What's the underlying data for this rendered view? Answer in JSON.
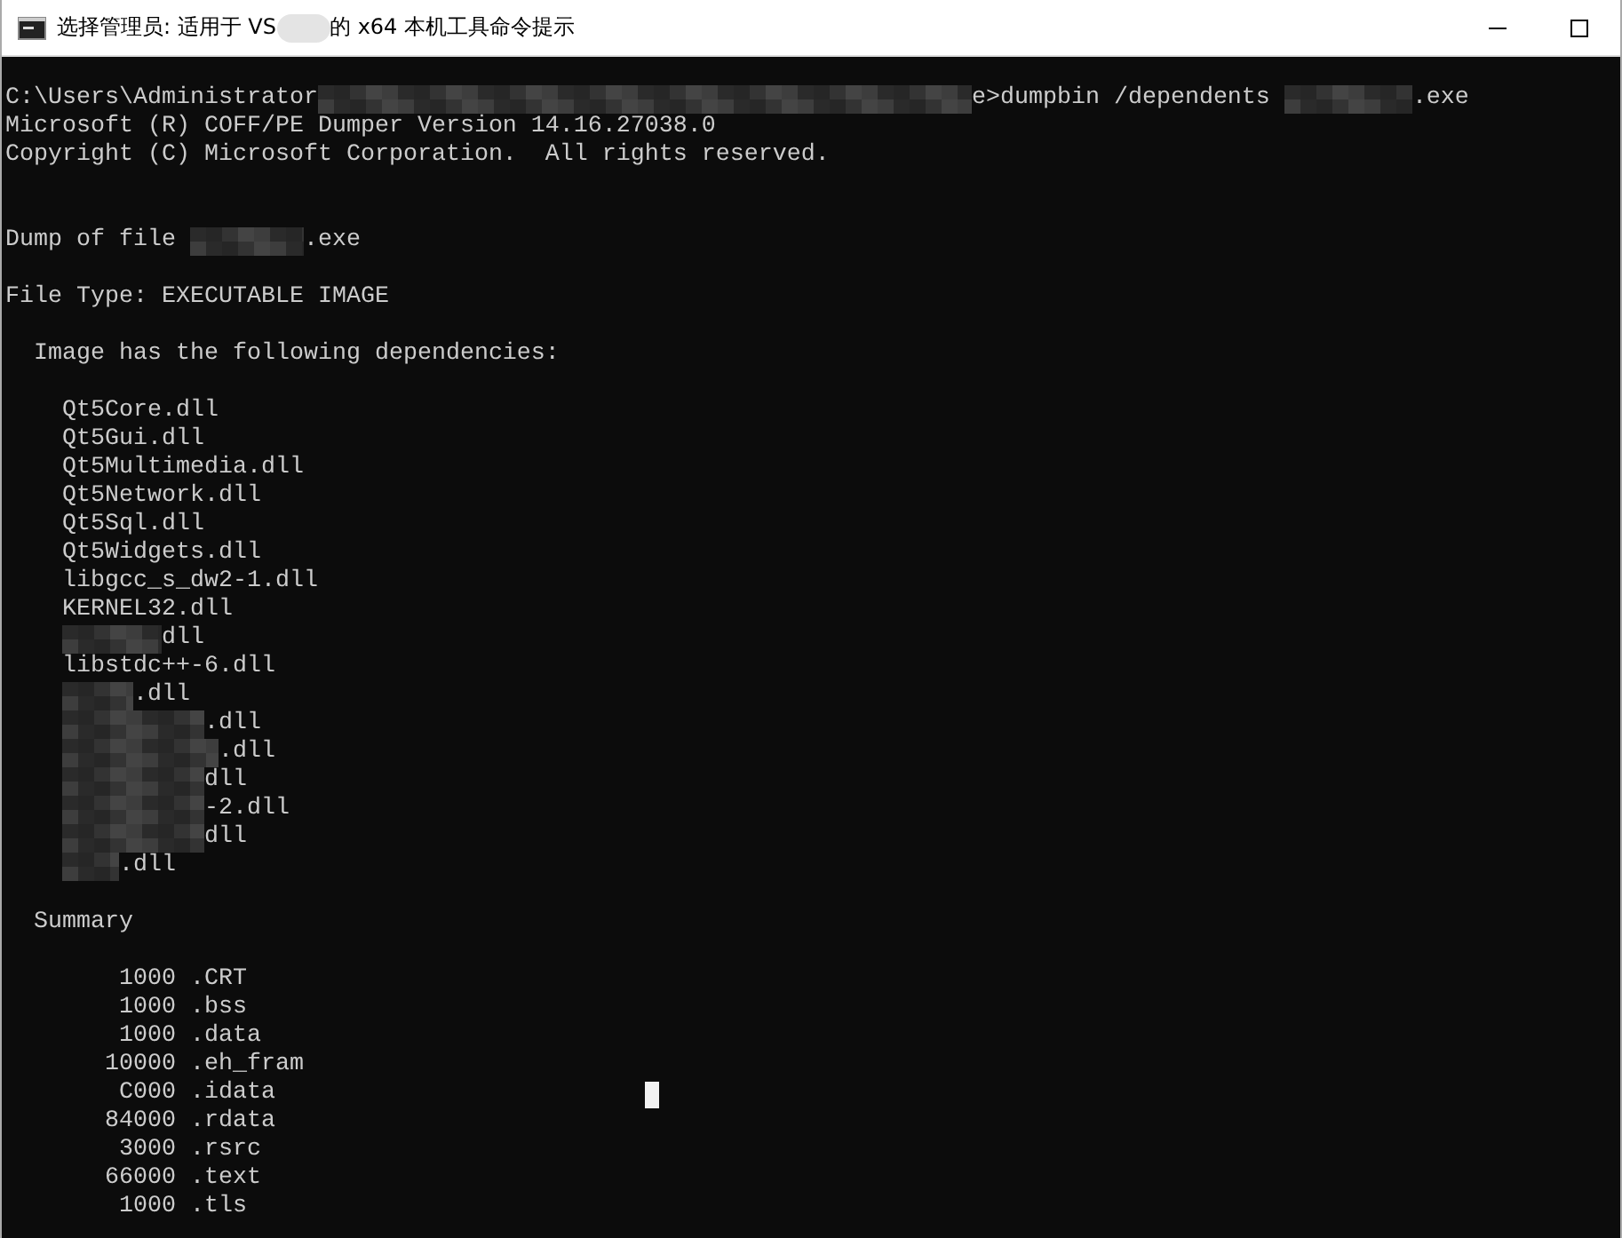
{
  "window": {
    "title": [
      {
        "kind": "text",
        "text": "选择管理员: 适用于 VS"
      },
      {
        "kind": "redacted"
      },
      {
        "kind": "text",
        "text": "的 x64 本机工具命令提示"
      }
    ]
  },
  "console": {
    "blocks": [
      [
        [
          {
            "kind": "text",
            "text": "C:\\Users\\Administrator"
          },
          {
            "kind": "redacted"
          },
          {
            "kind": "text",
            "text": "e>dumpbin /dependents "
          },
          {
            "kind": "redacted"
          },
          {
            "kind": "text",
            "text": ".exe"
          }
        ],
        [
          {
            "kind": "text",
            "text": "Microsoft (R) COFF/PE Dumper Version 14.16.27038.0"
          }
        ],
        [
          {
            "kind": "text",
            "text": "Copyright (C) Microsoft Corporation.  All rights reserved."
          }
        ]
      ],
      [
        [
          {
            "kind": "text",
            "text": "Dump of file "
          },
          {
            "kind": "redacted"
          },
          {
            "kind": "text",
            "text": ".exe"
          }
        ]
      ],
      [
        [
          {
            "kind": "text",
            "text": "File Type: EXECUTABLE IMAGE"
          }
        ]
      ],
      [
        [
          {
            "kind": "text",
            "text": "  Image has the following dependencies:"
          }
        ]
      ],
      [
        [
          {
            "kind": "text",
            "text": "    Qt5Core.dll"
          }
        ],
        [
          {
            "kind": "text",
            "text": "    Qt5Gui.dll"
          }
        ],
        [
          {
            "kind": "text",
            "text": "    Qt5Multimedia.dll"
          }
        ],
        [
          {
            "kind": "text",
            "text": "    Qt5Network.dll"
          }
        ],
        [
          {
            "kind": "text",
            "text": "    Qt5Sql.dll"
          }
        ],
        [
          {
            "kind": "text",
            "text": "    Qt5Widgets.dll"
          }
        ],
        [
          {
            "kind": "text",
            "text": "    libgcc_s_dw2-1.dll"
          }
        ],
        [
          {
            "kind": "text",
            "text": "    KERNEL32.dll"
          }
        ],
        [
          {
            "kind": "redacted"
          },
          {
            "kind": "text",
            "text": "dll"
          }
        ],
        [
          {
            "kind": "text",
            "text": "    libstdc++-6.dll"
          }
        ],
        [
          {
            "kind": "redacted"
          },
          {
            "kind": "text",
            "text": ".dll"
          }
        ],
        [
          {
            "kind": "redacted"
          },
          {
            "kind": "text",
            "text": ".dll"
          }
        ],
        [
          {
            "kind": "redacted"
          },
          {
            "kind": "text",
            "text": ".dll"
          }
        ],
        [
          {
            "kind": "redacted"
          },
          {
            "kind": "text",
            "text": "dll"
          }
        ],
        [
          {
            "kind": "redacted"
          },
          {
            "kind": "text",
            "text": "-2.dll"
          }
        ],
        [
          {
            "kind": "redacted"
          },
          {
            "kind": "text",
            "text": "dll"
          }
        ],
        [
          {
            "kind": "redacted"
          },
          {
            "kind": "text",
            "text": ".dll"
          }
        ]
      ],
      [
        [
          {
            "kind": "text",
            "text": "  Summary"
          }
        ]
      ],
      [
        [
          {
            "kind": "text",
            "text": "        1000 .CRT"
          }
        ],
        [
          {
            "kind": "text",
            "text": "        1000 .bss"
          }
        ],
        [
          {
            "kind": "text",
            "text": "        1000 .data"
          }
        ],
        [
          {
            "kind": "text",
            "text": "       10000 .eh_fram"
          }
        ],
        [
          {
            "kind": "text",
            "text": "        C000 .idata"
          },
          {
            "kind": "cursor"
          }
        ],
        [
          {
            "kind": "text",
            "text": "       84000 .rdata"
          }
        ],
        [
          {
            "kind": "text",
            "text": "        3000 .rsrc"
          }
        ],
        [
          {
            "kind": "text",
            "text": "       66000 .text"
          }
        ],
        [
          {
            "kind": "text",
            "text": "        1000 .tls"
          }
        ]
      ]
    ]
  }
}
